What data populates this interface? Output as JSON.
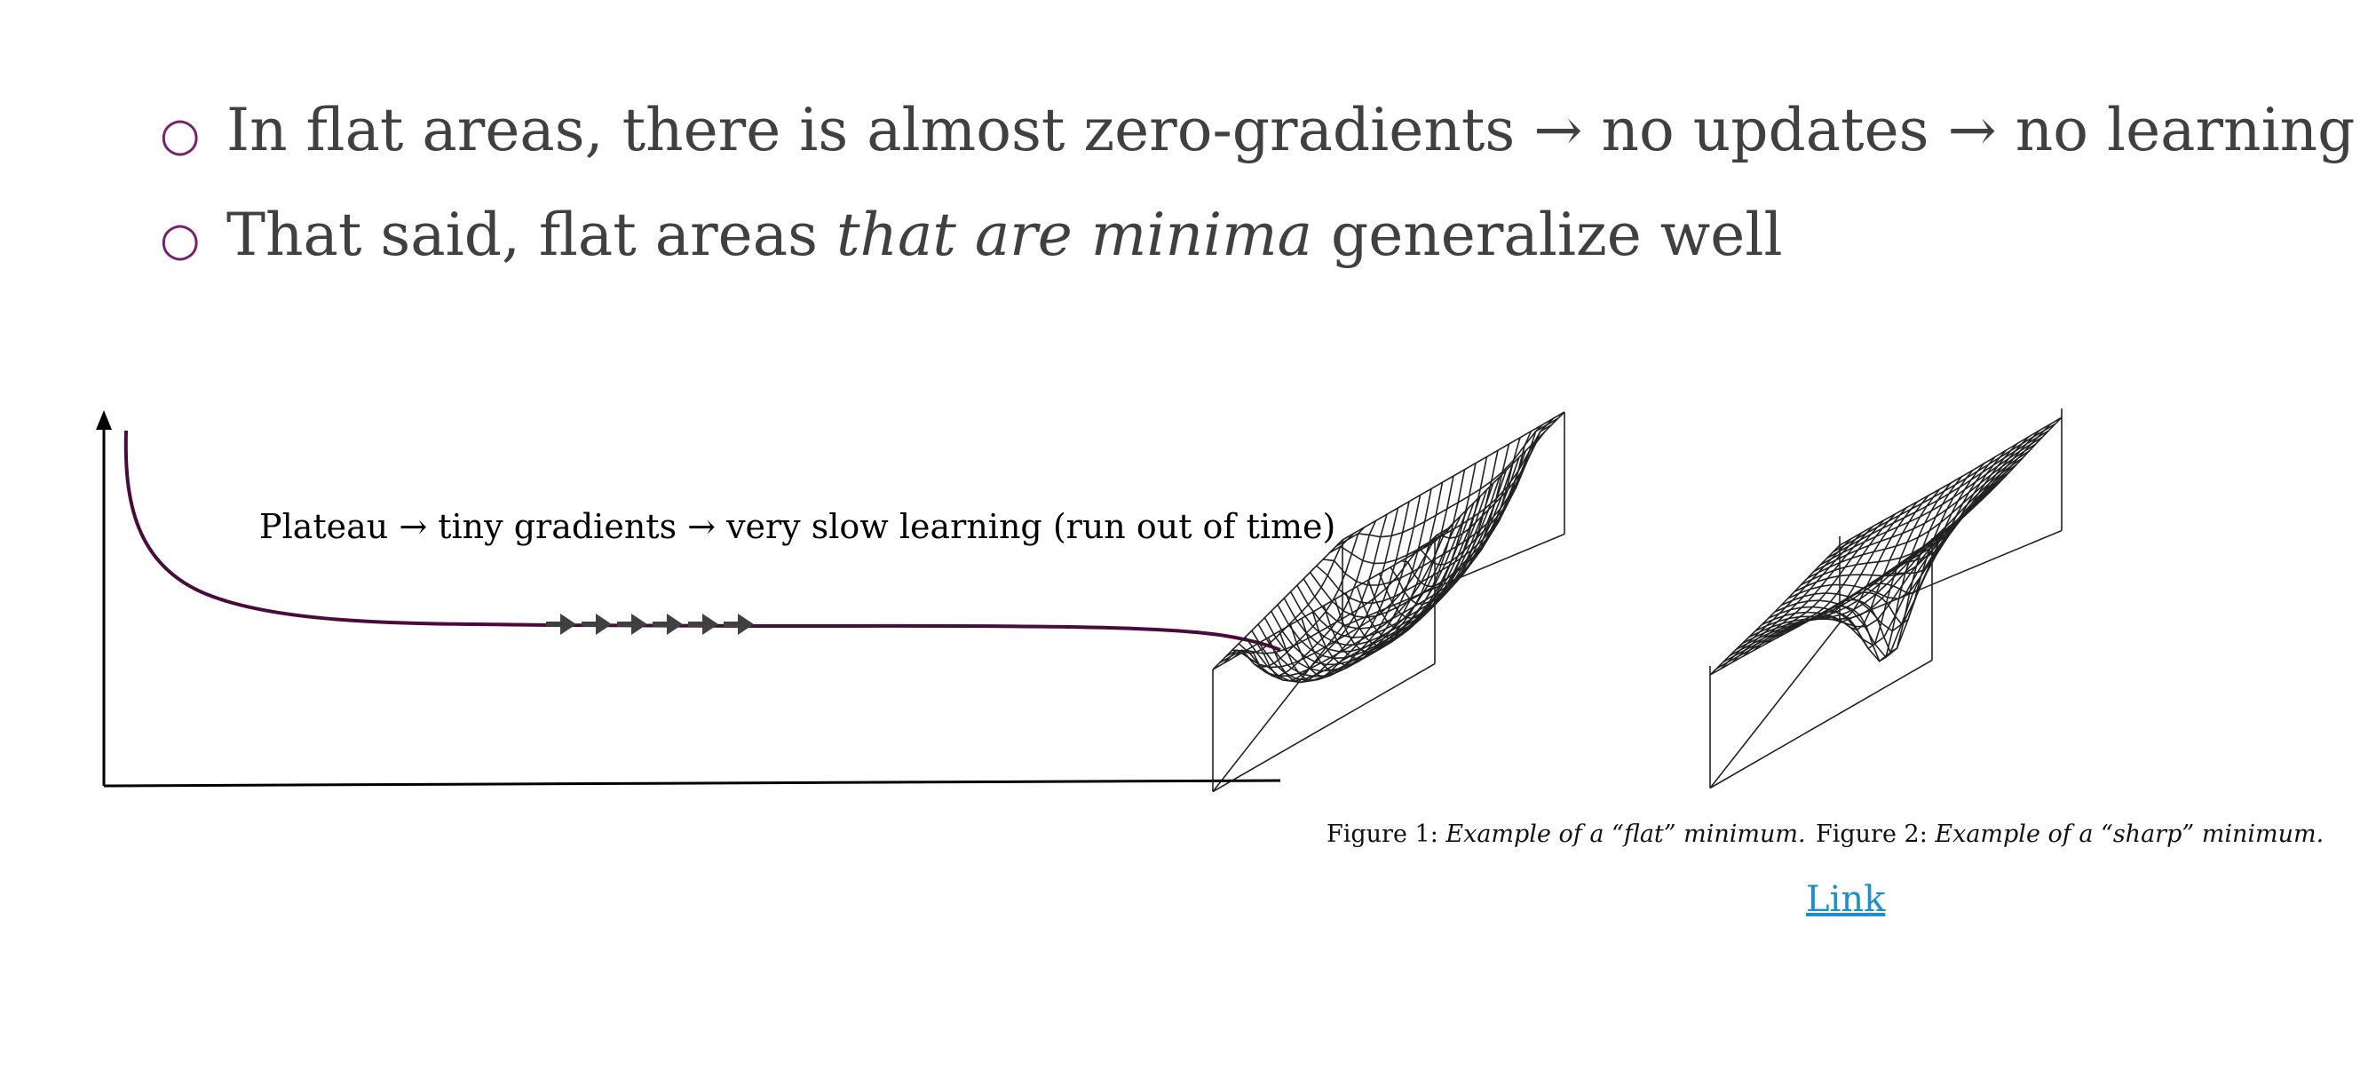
{
  "bullets": [
    {
      "marker": "○",
      "text_before": "In flat areas, there is almost zero-gradients → no updates → no learning",
      "italic": "",
      "text_after": ""
    },
    {
      "marker": "○",
      "text_before": "That said, flat areas ",
      "italic": "that are minima",
      "text_after": " generalize well"
    }
  ],
  "diagram": {
    "label": "Plateau → tiny gradients → very slow learning (run out of time)",
    "step_arrow_count": 6,
    "curve_color": "#4a0a3c",
    "arrow_color": "#404040"
  },
  "figures": [
    {
      "number": "Figure 1:",
      "caption": "Example of a “flat” minimum.",
      "surface": "flat"
    },
    {
      "number": "Figure 2:",
      "caption": "Example of a “sharp” minimum.",
      "surface": "sharp"
    }
  ],
  "link": {
    "label": "Link",
    "color": "#1a8fd1"
  },
  "colors": {
    "bullet_marker": "#7a1f6e",
    "text": "#404040"
  }
}
